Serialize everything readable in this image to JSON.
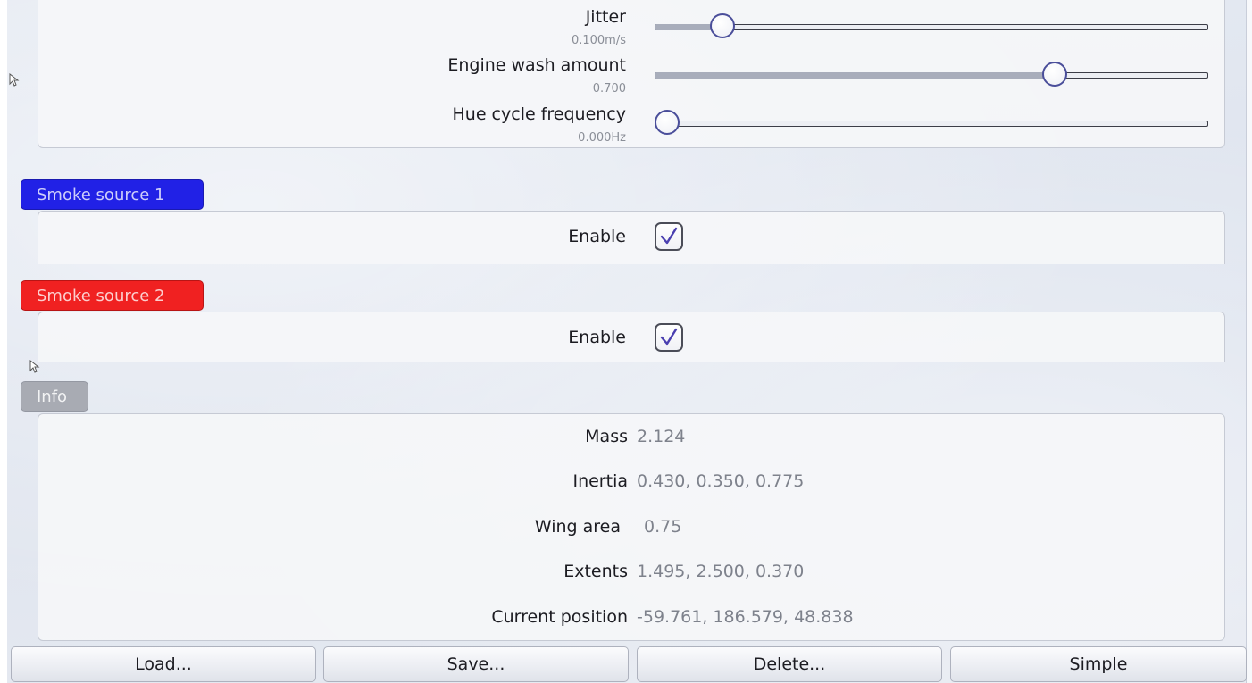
{
  "sliders": [
    {
      "label": "Jitter",
      "value": "0.100m/s",
      "position": 0.1
    },
    {
      "label": "Engine wash amount",
      "value": "0.700",
      "position": 0.7
    },
    {
      "label": "Hue cycle frequency",
      "value": "0.000Hz",
      "position": 0.0
    }
  ],
  "smoke_source_1": {
    "tab_label": "Smoke source 1",
    "tab_color": "#2121e6",
    "enable_label": "Enable",
    "enabled": true
  },
  "smoke_source_2": {
    "tab_label": "Smoke source 2",
    "tab_color": "#f02121",
    "enable_label": "Enable",
    "enabled": true
  },
  "info": {
    "tab_label": "Info",
    "rows": [
      {
        "label": "Mass",
        "value": "2.124"
      },
      {
        "label": "Inertia",
        "value": "0.430, 0.350, 0.775"
      },
      {
        "label": "Wing area",
        "value": "0.75"
      },
      {
        "label": "Extents",
        "value": "1.495, 2.500, 0.370"
      },
      {
        "label": "Current position",
        "value": "-59.761, 186.579, 48.838"
      }
    ]
  },
  "buttons": {
    "load": "Load...",
    "save": "Save...",
    "delete": "Delete...",
    "simple": "Simple"
  },
  "icons": {
    "checkbox_check": "check-icon",
    "pointer": "cursor-icon"
  }
}
